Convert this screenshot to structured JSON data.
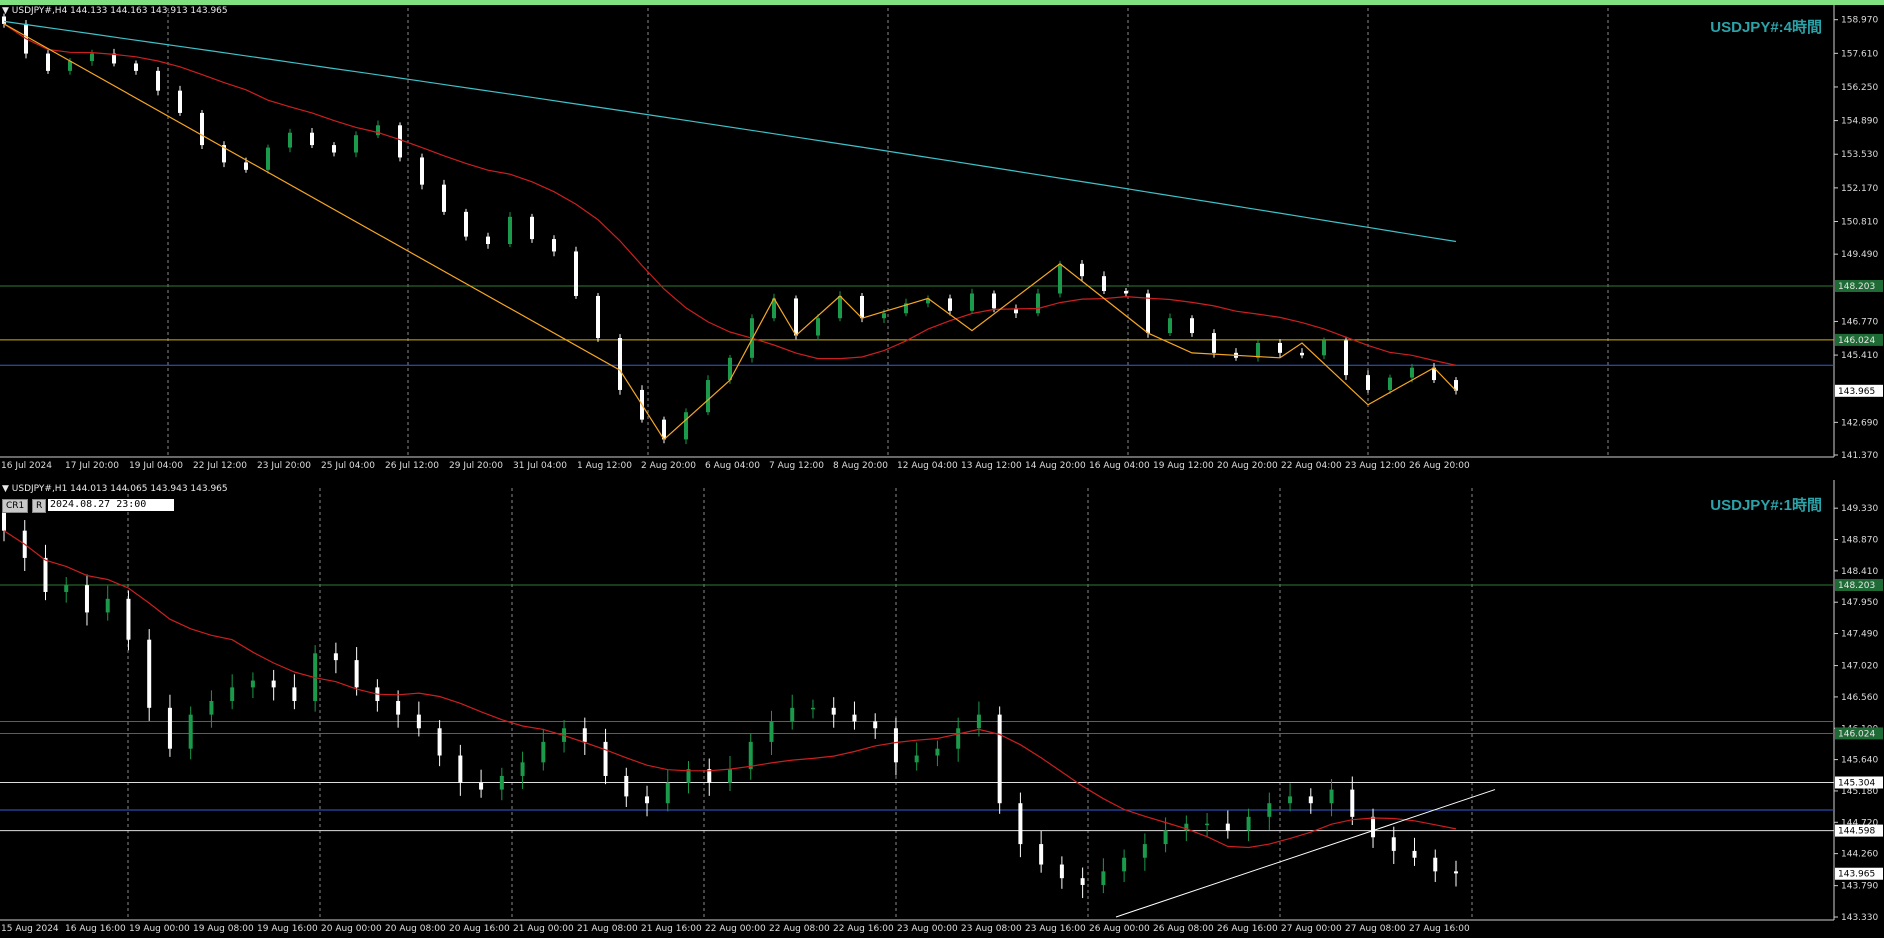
{
  "top": {
    "header": "USDJPY#,H4  144.133 144.163 143.913 143.965",
    "symbol_label": "USDJPY#:4時間",
    "price_labels": [
      "158.970",
      "157.610",
      "156.250",
      "154.890",
      "153.530",
      "152.170",
      "150.810",
      "149.490",
      "146.770",
      "145.410",
      "142.690",
      "141.370"
    ],
    "line_labels": {
      "green": "148.203",
      "yellow": "146.024",
      "current": "143.965"
    },
    "time_labels": [
      "16 Jul 2024",
      "17 Jul 20:00",
      "19 Jul 04:00",
      "22 Jul 12:00",
      "23 Jul 20:00",
      "25 Jul 04:00",
      "26 Jul 12:00",
      "29 Jul 20:00",
      "31 Jul 04:00",
      "1 Aug 12:00",
      "2 Aug 20:00",
      "6 Aug 04:00",
      "7 Aug 12:00",
      "8 Aug 20:00",
      "12 Aug 04:00",
      "13 Aug 12:00",
      "14 Aug 20:00",
      "16 Aug 04:00",
      "19 Aug 12:00",
      "20 Aug 20:00",
      "22 Aug 04:00",
      "23 Aug 12:00",
      "26 Aug 20:00"
    ]
  },
  "bottom": {
    "header": "USDJPY#,H1  144.013 144.065 143.943 143.965",
    "symbol_label": "USDJPY#:1時間",
    "buttons": [
      "CR1",
      "R"
    ],
    "date_box": "2024.08.27 23:00",
    "price_labels": [
      "149.330",
      "148.870",
      "148.410",
      "147.950",
      "147.490",
      "147.020",
      "146.560",
      "146.100",
      "145.640",
      "145.180",
      "144.720",
      "144.260",
      "143.790",
      "143.330"
    ],
    "line_labels": {
      "green_top": "148.203",
      "green_mid": "146.024",
      "white_top": "145.304",
      "white_bottom": "144.598",
      "current": "143.965"
    },
    "time_labels": [
      "15 Aug 2024",
      "16 Aug 16:00",
      "19 Aug 00:00",
      "19 Aug 08:00",
      "19 Aug 16:00",
      "20 Aug 00:00",
      "20 Aug 08:00",
      "20 Aug 16:00",
      "21 Aug 00:00",
      "21 Aug 08:00",
      "21 Aug 16:00",
      "22 Aug 00:00",
      "22 Aug 08:00",
      "22 Aug 16:00",
      "23 Aug 00:00",
      "23 Aug 08:00",
      "23 Aug 16:00",
      "26 Aug 00:00",
      "26 Aug 08:00",
      "26 Aug 16:00",
      "27 Aug 00:00",
      "27 Aug 08:00",
      "27 Aug 16:00"
    ]
  },
  "colors": {
    "bull": "#1a9a4a",
    "bear": "#ffffff",
    "ma_red": "#cc1f1f",
    "ma_cyan": "#3fc1c9",
    "zigzag": "#f5a623",
    "green_line": "#2e7d32",
    "yellow_line": "#d4b000",
    "blue_line": "#2f5fd6",
    "white_line": "#dddddd",
    "grid": "#8a8a8a",
    "accent": "#2aa3a9"
  },
  "chart_data": [
    {
      "type": "line",
      "title": "USDJPY#:4時間",
      "ylim": [
        141.37,
        159.2
      ],
      "horizontal_lines": [
        148.203,
        146.024,
        145.0
      ],
      "current_price": 143.965,
      "series": [
        {
          "values": [
            158.8,
            157.6,
            156.9,
            157.3,
            157.6,
            157.2,
            156.9,
            156.1,
            155.2,
            153.9,
            153.2,
            152.9,
            153.8,
            154.4,
            153.9,
            153.6,
            154.3,
            154.7,
            153.4,
            152.3,
            151.2,
            150.2,
            149.9,
            151.0,
            150.1,
            149.6,
            147.8,
            146.1,
            144.0,
            142.8,
            142.0,
            143.1,
            144.4,
            145.3,
            146.9,
            147.7,
            146.2,
            146.9,
            147.8,
            146.9,
            147.1,
            147.5,
            147.7,
            147.2,
            147.9,
            147.3,
            147.1,
            147.9,
            149.1,
            148.6,
            148.0,
            147.9,
            146.3,
            146.9,
            146.3,
            145.5,
            145.3,
            145.9,
            145.5,
            145.4,
            146.0,
            144.6,
            144.0,
            144.5,
            144.9,
            144.4,
            143.97
          ]
        }
      ]
    },
    {
      "type": "line",
      "title": "USDJPY#:1時間",
      "ylim": [
        143.33,
        149.45
      ],
      "horizontal_lines": [
        148.203,
        146.024,
        145.304,
        144.598,
        146.2,
        144.9
      ],
      "current_price": 143.965,
      "series": [
        {
          "values": [
            149.0,
            148.6,
            148.1,
            148.2,
            147.8,
            148.0,
            147.4,
            146.4,
            145.8,
            146.3,
            146.5,
            146.7,
            146.8,
            146.7,
            146.5,
            147.2,
            147.1,
            146.7,
            146.5,
            146.3,
            146.1,
            145.7,
            145.3,
            145.2,
            145.4,
            145.6,
            145.9,
            146.1,
            145.9,
            145.4,
            145.1,
            145.0,
            145.3,
            145.5,
            145.3,
            145.5,
            145.9,
            146.2,
            146.4,
            146.4,
            146.3,
            146.2,
            146.1,
            145.6,
            145.7,
            145.8,
            146.1,
            146.3,
            145.0,
            144.4,
            144.1,
            143.9,
            143.8,
            144.0,
            144.2,
            144.4,
            144.6,
            144.7,
            144.7,
            144.6,
            144.8,
            145.0,
            145.1,
            145.0,
            145.2,
            144.8,
            144.5,
            144.3,
            144.2,
            144.0,
            143.97
          ]
        }
      ]
    }
  ]
}
